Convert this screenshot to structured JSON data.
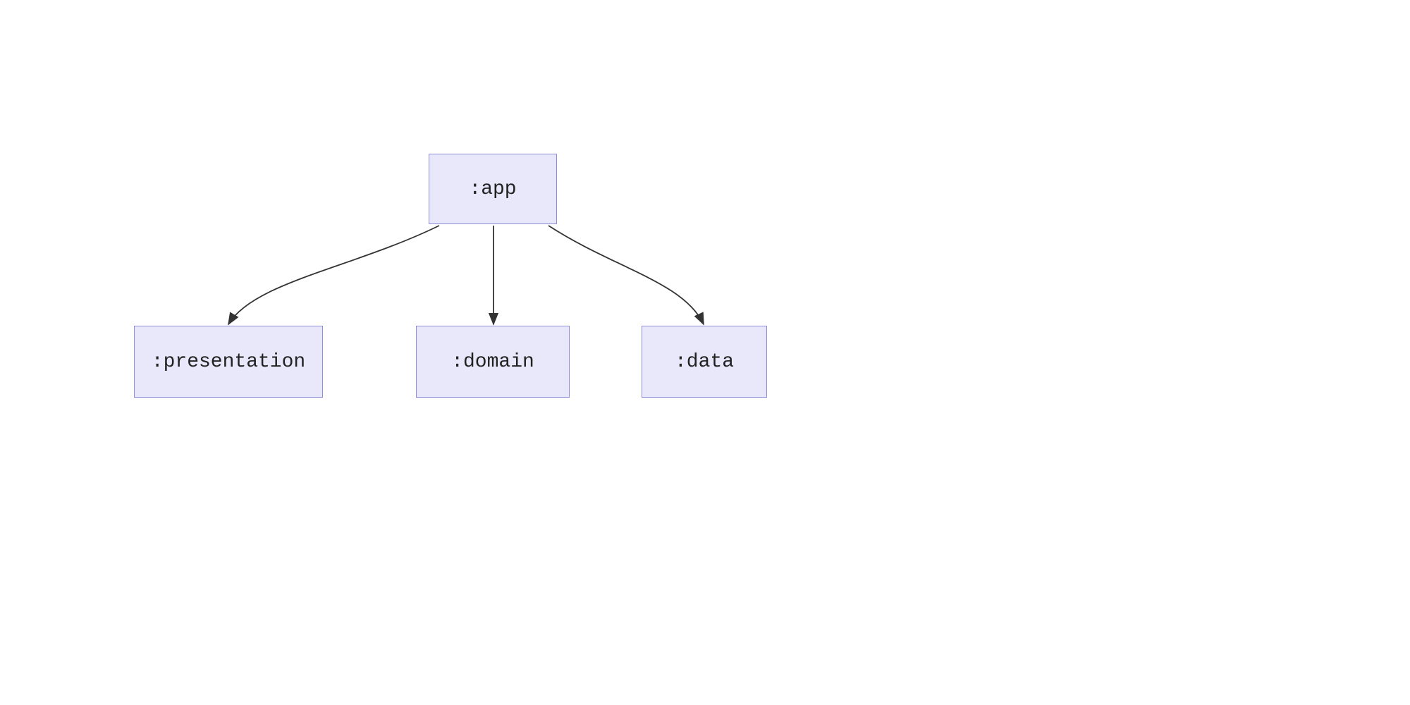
{
  "nodes": {
    "app": {
      "label": ":app"
    },
    "presentation": {
      "label": ":presentation"
    },
    "domain": {
      "label": ":domain"
    },
    "data": {
      "label": ":data"
    }
  },
  "colors": {
    "nodeFill": "#e8e8fa",
    "nodeBorder": "#8e8ed6",
    "edge": "#333333"
  }
}
